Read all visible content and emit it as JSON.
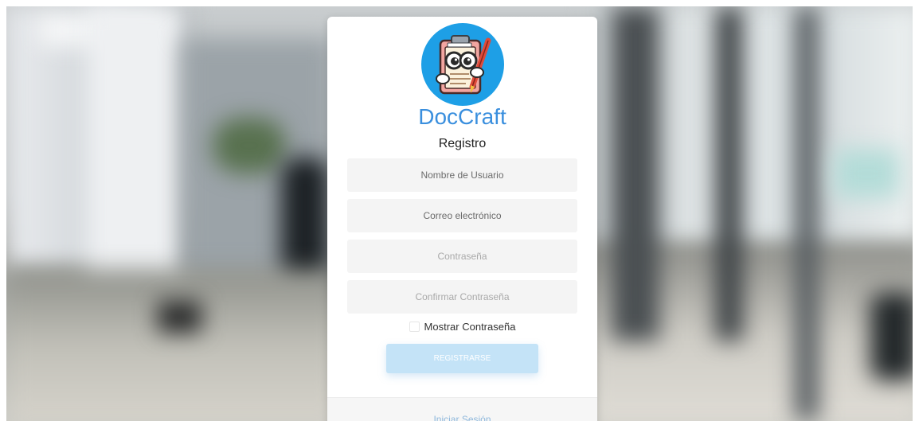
{
  "brand": {
    "name": "DocCraft"
  },
  "form": {
    "title": "Registro",
    "username_placeholder": "Nombre de Usuario",
    "email_placeholder": "Correo electrónico",
    "password_placeholder": "Contraseña",
    "confirm_password_placeholder": "Confirmar Contraseña",
    "show_password_label": "Mostrar Contraseña",
    "show_password_checked": false,
    "register_button": "REGISTRARSE"
  },
  "footer": {
    "login_link": "Iniciar Sesión"
  },
  "colors": {
    "brand_text": "#3a8fde",
    "logo_bg": "#1e9fe6",
    "button_bg": "#c4e3f7",
    "link": "#8fb8dc"
  }
}
